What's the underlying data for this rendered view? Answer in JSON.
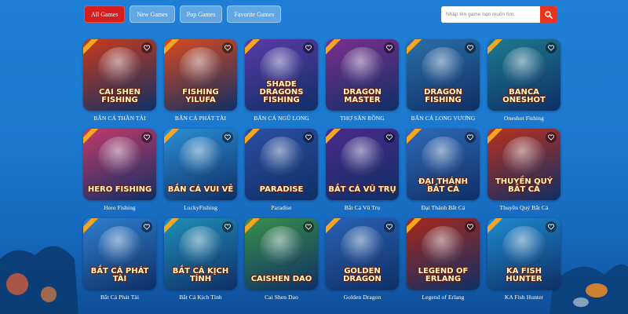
{
  "tabs": [
    {
      "label": "All Games",
      "active": true
    },
    {
      "label": "New Games",
      "active": false
    },
    {
      "label": "Pop Games",
      "active": false
    },
    {
      "label": "Favorite Games",
      "active": false
    }
  ],
  "search": {
    "placeholder": "Nhập tên game bạn muốn tìm.",
    "icon": "search-icon"
  },
  "games": [
    {
      "name": "BẮN CÁ THẦN TÀI",
      "logo": "Cai Shen Fishing",
      "color": "#c93b1a"
    },
    {
      "name": "BẮN CÁ PHÁT TÀI",
      "logo": "Fishing Yilufa",
      "color": "#d94a1e"
    },
    {
      "name": "BẮN CÁ NGŨ LONG",
      "logo": "Shade Dragons Fishing",
      "color": "#5a3aa8"
    },
    {
      "name": "THỢ SĂN RỒNG",
      "logo": "Dragon Master",
      "color": "#7b2f8c"
    },
    {
      "name": "BẮN CÁ LONG VƯƠNG",
      "logo": "Dragon Fishing",
      "color": "#2b6fa8"
    },
    {
      "name": "Oneshot Fishing",
      "logo": "Banca Oneshot",
      "color": "#1d7a8f"
    },
    {
      "name": "Hero Fishing",
      "logo": "Hero Fishing",
      "color": "#c23a6a"
    },
    {
      "name": "LuckyFishing",
      "logo": "Bắn Cá Vui Vẻ",
      "color": "#2a8fd6"
    },
    {
      "name": "Paradise",
      "logo": "Paradise",
      "color": "#2a4fa3"
    },
    {
      "name": "Bắt Cá Vũ Trụ",
      "logo": "Bắt Cá Vũ Trụ",
      "color": "#4b2a8a"
    },
    {
      "name": "Đại Thánh Bắt Cá",
      "logo": "Đại Thánh Bắt Cá",
      "color": "#2f6ab8"
    },
    {
      "name": "Thuyền Quý Bắt Cá",
      "logo": "Thuyền Quý Bắt Cá",
      "color": "#b8301f"
    },
    {
      "name": "Bắt Cá Phát Tài",
      "logo": "Bắt Cá Phát Tài",
      "color": "#2f7fcf"
    },
    {
      "name": "Bắt Cá Kịch Tính",
      "logo": "Bắt Cá Kịch Tính",
      "color": "#1f8fb8"
    },
    {
      "name": "Cai Shen Dao",
      "logo": "Caishen Dao",
      "color": "#3a8f4a"
    },
    {
      "name": "Golden Dragon",
      "logo": "Golden Dragon",
      "color": "#2a62b5"
    },
    {
      "name": "Legend of Erlang",
      "logo": "Legend of Erlang",
      "color": "#a8281c"
    },
    {
      "name": "KA Fish Hunter",
      "logo": "KA Fish Hunter",
      "color": "#1e8ad0"
    }
  ]
}
